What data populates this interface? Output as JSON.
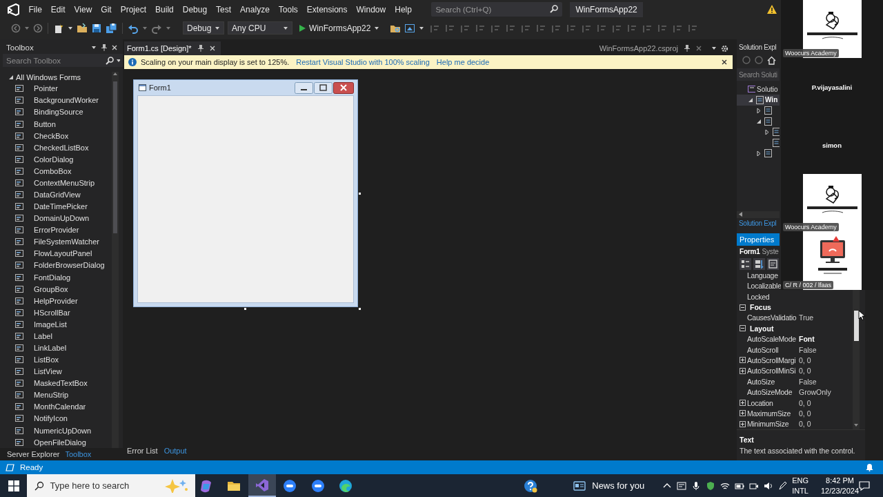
{
  "menu": [
    "File",
    "Edit",
    "View",
    "Git",
    "Project",
    "Build",
    "Debug",
    "Test",
    "Analyze",
    "Tools",
    "Extensions",
    "Window",
    "Help"
  ],
  "search": {
    "placeholder": "Search (Ctrl+Q)"
  },
  "solution_title": "WinFormsApp22",
  "toolbar": {
    "configuration": "Debug",
    "platform": "Any CPU",
    "start": "WinFormsApp22"
  },
  "toolbox": {
    "title": "Toolbox",
    "search": {
      "placeholder": "Search Toolbox"
    },
    "group": {
      "label": "All Windows Forms",
      "expanded": true,
      "items": [
        "Pointer",
        "BackgroundWorker",
        "BindingSource",
        "Button",
        "CheckBox",
        "CheckedListBox",
        "ColorDialog",
        "ComboBox",
        "ContextMenuStrip",
        "DataGridView",
        "DateTimePicker",
        "DomainUpDown",
        "ErrorProvider",
        "FileSystemWatcher",
        "FlowLayoutPanel",
        "FolderBrowserDialog",
        "FontDialog",
        "GroupBox",
        "HelpProvider",
        "HScrollBar",
        "ImageList",
        "Label",
        "LinkLabel",
        "ListBox",
        "ListView",
        "MaskedTextBox",
        "MenuStrip",
        "MonthCalendar",
        "NotifyIcon",
        "NumericUpDown",
        "OpenFileDialog"
      ]
    }
  },
  "toolbox_tabs": [
    {
      "label": "Server Explorer",
      "selected": false
    },
    {
      "label": "Toolbox",
      "selected": true
    }
  ],
  "document_tabs": [
    {
      "label": "Form1.cs [Design]*",
      "selected": true
    },
    {
      "label": "WinFormsApp22.csproj",
      "selected": false
    }
  ],
  "info_bar": {
    "message": "Scaling on your main display is set to 125%.",
    "links": [
      "Restart Visual Studio with 100% scaling",
      "Help me decide"
    ]
  },
  "form": {
    "title": "Form1"
  },
  "bottom_tabs": [
    {
      "label": "Error List",
      "selected": false
    },
    {
      "label": "Output",
      "selected": true
    }
  ],
  "solution_explorer": {
    "title": "Solution Expl",
    "search": {
      "placeholder": "Search Soluti"
    },
    "tree": [
      {
        "label": "Solutio",
        "selected": false,
        "children": [
          {
            "label": "Win",
            "selected": true,
            "expanded": true,
            "children": [
              {
                "selected": false,
                "expanded": false
              },
              {
                "selected": false,
                "expanded": true,
                "children": [
                  {
                    "selected": false,
                    "expanded": false
                  },
                  {
                    "selected": false
                  }
                ]
              },
              {
                "selected": false,
                "expanded": false
              }
            ]
          }
        ]
      }
    ],
    "tab": {
      "label": "Solution Expl",
      "selected": true
    }
  },
  "properties": {
    "title": "Properties",
    "object": "Form1",
    "type": "Syste",
    "rows": [
      {
        "kind": "property",
        "name": "Language",
        "expandable": false
      },
      {
        "kind": "property",
        "name": "Localizable",
        "expandable": false
      },
      {
        "kind": "property",
        "name": "Locked",
        "expandable": false
      },
      {
        "kind": "category",
        "name": "Focus",
        "expanded": true
      },
      {
        "kind": "property",
        "name": "CausesValidatio",
        "value": "True",
        "expandable": false,
        "modified": false
      },
      {
        "kind": "category",
        "name": "Layout",
        "expanded": true
      },
      {
        "kind": "property",
        "name": "AutoScaleMode",
        "value": "Font",
        "expandable": false,
        "modified": true
      },
      {
        "kind": "property",
        "name": "AutoScroll",
        "value": "False",
        "expandable": false,
        "modified": false
      },
      {
        "kind": "property",
        "name": "AutoScrollMargi",
        "value": "0, 0",
        "expandable": true,
        "modified": false
      },
      {
        "kind": "property",
        "name": "AutoScrollMinSi",
        "value": "0, 0",
        "expandable": true,
        "modified": false
      },
      {
        "kind": "property",
        "name": "AutoSize",
        "value": "False",
        "expandable": false,
        "modified": false
      },
      {
        "kind": "property",
        "name": "AutoSizeMode",
        "value": "GrowOnly",
        "expandable": false,
        "modified": false
      },
      {
        "kind": "property",
        "name": "Location",
        "value": "0, 0",
        "expandable": true,
        "modified": false
      },
      {
        "kind": "property",
        "name": "MaximumSize",
        "value": "0, 0",
        "expandable": true,
        "modified": false
      },
      {
        "kind": "property",
        "name": "MinimumSize",
        "value": "0, 0",
        "expandable": true,
        "modified": false
      }
    ],
    "description": {
      "title": "Text",
      "text": "The text associated with the control."
    }
  },
  "status_bar": {
    "text": "Ready"
  },
  "taskbar": {
    "search": {
      "placeholder": "Type here to search"
    },
    "apps": [
      {
        "kind": "copilot",
        "selected": false
      },
      {
        "kind": "folder",
        "selected": false
      },
      {
        "kind": "studio",
        "selected": true
      },
      {
        "kind": "meeting",
        "selected": false
      },
      {
        "kind": "meeting",
        "selected": false
      },
      {
        "kind": "browser",
        "selected": false
      }
    ],
    "news": "News for you",
    "language": "ENG",
    "layout": "INTL",
    "time": "8:42 PM",
    "date": "12/23/2024"
  },
  "meeting_panel": {
    "tiles": [
      {
        "kind": "picture",
        "label": "Woocurs Academy"
      },
      {
        "kind": "name",
        "name": "P.vijayasalini"
      },
      {
        "kind": "name",
        "name": "simon"
      },
      {
        "kind": "picture",
        "label": "Woocurs Academy"
      },
      {
        "kind": "picture",
        "label": "C/ R / 002 / lfaas"
      }
    ]
  }
}
